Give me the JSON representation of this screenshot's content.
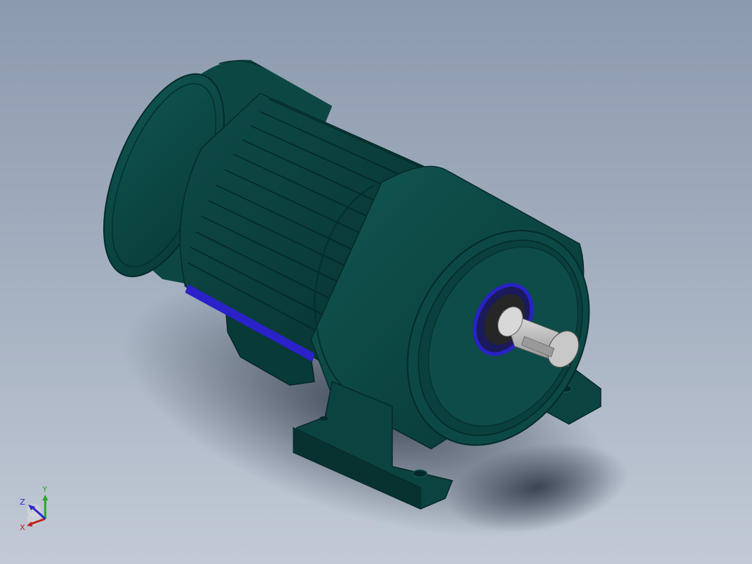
{
  "viewport": {
    "background_top": "#8c9aae",
    "background_bottom": "#c2cad6"
  },
  "model": {
    "body_color": "#0d4a47",
    "body_dark": "#073432",
    "body_light": "#145c57",
    "seal_color": "#2a21c8",
    "shaft_color": "#bcbcbc"
  },
  "triad": {
    "x_label": "X",
    "y_label": "Y",
    "z_label": "Z",
    "x_color": "#c0201a",
    "y_color": "#2aa62a",
    "z_color": "#2a2ac8"
  }
}
